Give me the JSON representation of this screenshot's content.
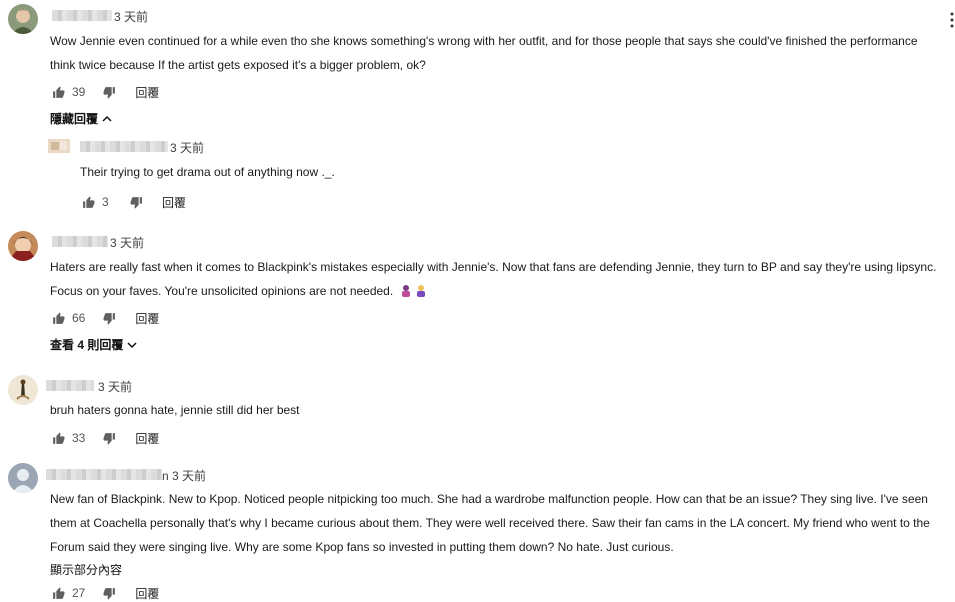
{
  "comments": [
    {
      "time": "3 天前",
      "text_lines": [
        "Wow Jennie even continued for a while even tho she knows something's wrong with her outfit, and for those people that says she could've finished the performance",
        "think twice because If the artist gets exposed it's a bigger problem, ok?"
      ],
      "likes": "39",
      "reply_label": "回覆",
      "toggle_label": "隱藏回覆"
    },
    {
      "time": "3 天前",
      "text_lines": [
        "Their trying to get drama out of anything now ._."
      ],
      "likes": "3",
      "reply_label": "回覆"
    },
    {
      "time": "3 天前",
      "text_lines": [
        "Haters are really fast when it comes to Blackpink's mistakes especially with Jennie's. Now that fans are defending Jennie,  they turn to BP and say they're using lipsync.",
        "Focus on your faves. You're unsolicited opinions are not needed."
      ],
      "likes": "66",
      "reply_label": "回覆",
      "toggle_label": "查看 4 則回覆"
    },
    {
      "time": "3 天前",
      "text_lines": [
        "bruh haters gonna hate, jennie still did her best"
      ],
      "likes": "33",
      "reply_label": "回覆"
    },
    {
      "name_suffix": "n",
      "time": "3 天前",
      "text_lines": [
        "New fan of Blackpink. New to Kpop. Noticed people nitpicking too much. She had a wardrobe malfunction people. How can that be an issue? They sing live. I've seen",
        "them at Coachella personally that's why I became curious about them. They were well received there. Saw their fan cams in the LA concert. My friend who went to the",
        "Forum said they were singing live. Why are some Kpop fans so invested in putting them down? No hate. Just curious."
      ],
      "show_more_label": "顯示部分內容",
      "likes": "27",
      "reply_label": "回覆"
    }
  ],
  "icons": {
    "like": "thumb-up-icon",
    "dislike": "thumb-down-icon",
    "more": "more-vert-icon",
    "chevron_up": "chevron-up-icon",
    "chevron_down": "chevron-down-icon"
  }
}
